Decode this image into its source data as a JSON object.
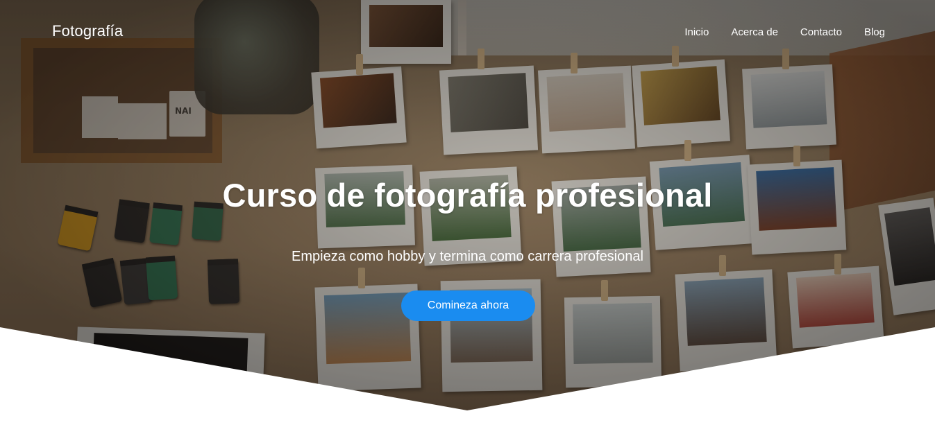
{
  "navbar": {
    "brand": "Fotografía",
    "links": [
      {
        "label": "Inicio"
      },
      {
        "label": "Acerca de"
      },
      {
        "label": "Contacto"
      },
      {
        "label": "Blog"
      }
    ]
  },
  "hero": {
    "title": "Curso de fotografía profesional",
    "subtitle": "Empieza como hobby y termina como carrera profesional",
    "cta_label": "Comineza ahora",
    "background_image": "photos-on-table",
    "logo_text": "NAI"
  },
  "colors": {
    "accent": "#1a8cf0",
    "text_on_hero": "#ffffff",
    "page_background": "#ffffff"
  }
}
